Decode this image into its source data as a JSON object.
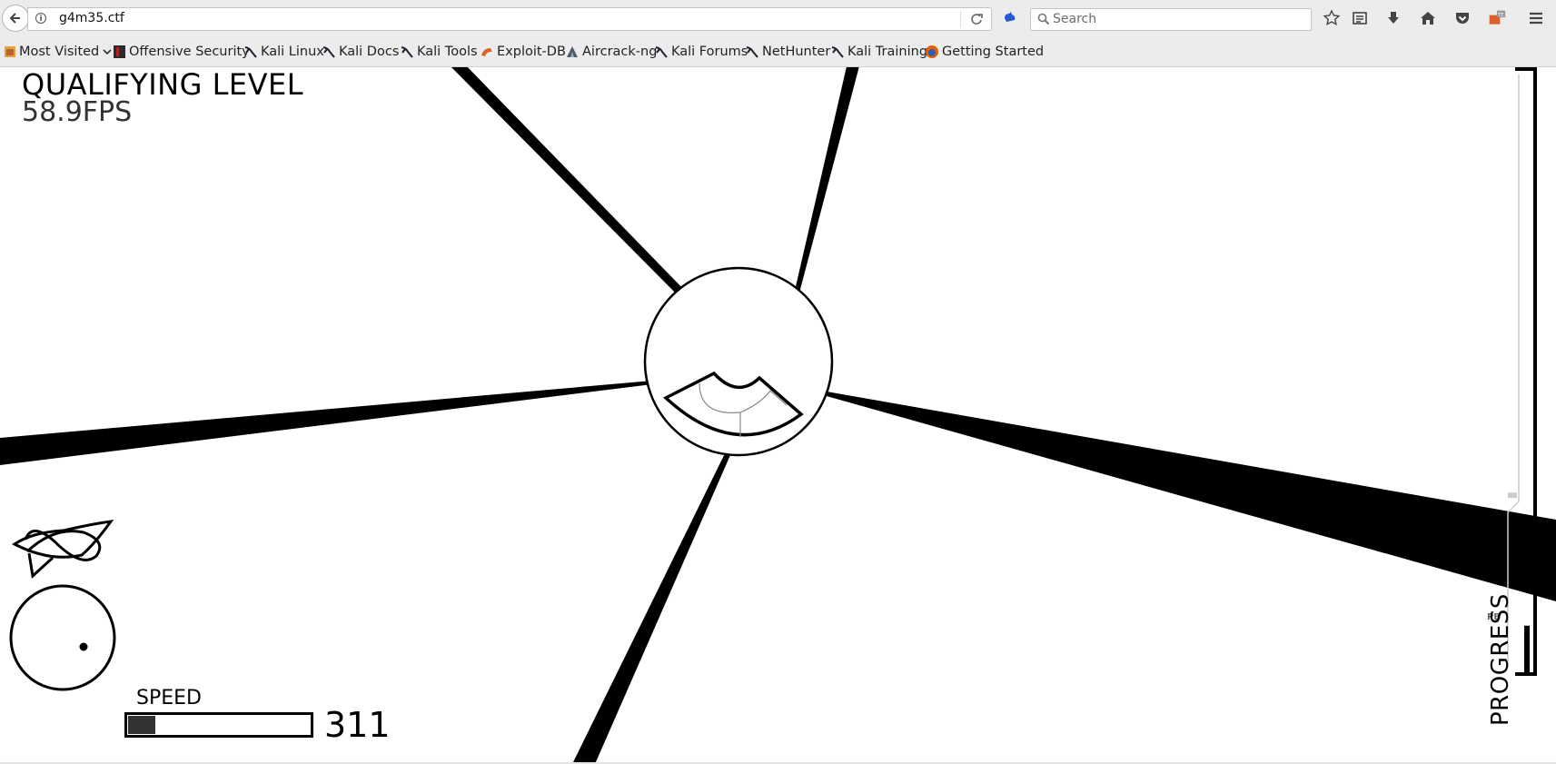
{
  "browser": {
    "url": "g4m35.ctf",
    "search_placeholder": "Search",
    "bookmarks": [
      {
        "label": "Most Visited",
        "icon": "most-visited-icon"
      },
      {
        "label": "Offensive Security",
        "icon": "offsec-icon"
      },
      {
        "label": "Kali Linux",
        "icon": "kali-dragon-icon"
      },
      {
        "label": "Kali Docs",
        "icon": "kali-dragon-icon"
      },
      {
        "label": "Kali Tools",
        "icon": "kali-dragon-icon"
      },
      {
        "label": "Exploit-DB",
        "icon": "exploit-db-icon"
      },
      {
        "label": "Aircrack-ng",
        "icon": "aircrack-icon"
      },
      {
        "label": "Kali Forums",
        "icon": "kali-dragon-icon"
      },
      {
        "label": "NetHunter",
        "icon": "kali-dragon-icon"
      },
      {
        "label": "Kali Training",
        "icon": "kali-dragon-icon"
      },
      {
        "label": "Getting Started",
        "icon": "firefox-icon"
      }
    ],
    "toolbar_icons": [
      "bookmark-star-icon",
      "reading-list-icon",
      "download-icon",
      "home-icon",
      "pocket-icon",
      "extension-icon",
      "menu-icon"
    ]
  },
  "game": {
    "level_title": "QUALIFYING LEVEL",
    "fps": "58.9FPS",
    "speed_label": "SPEED",
    "speed_value": "311",
    "speed_fraction": 0.15,
    "progress_label": "PROGRESS",
    "progress_fraction": 0.08,
    "personal_best_label": "PB",
    "personal_best_fraction": 0.3,
    "colors": {
      "foreground": "#000000",
      "background": "#ffffff",
      "speed_fill": "#333333"
    }
  }
}
